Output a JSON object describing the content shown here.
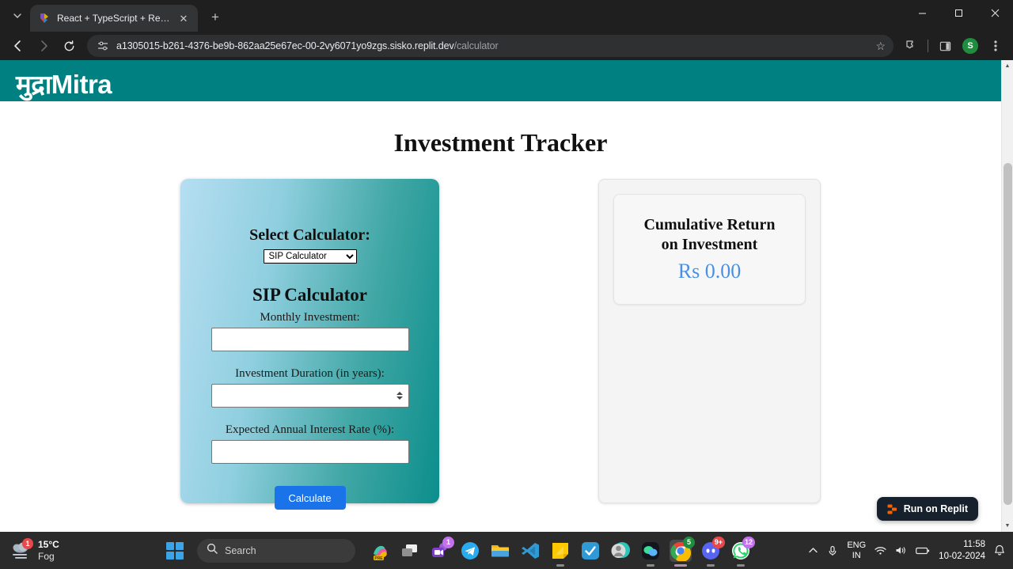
{
  "browser": {
    "tab": {
      "title": "React + TypeScript + Replit",
      "favicon_icon": "replit-favicon",
      "close_icon": "close-icon"
    },
    "tab_list_icon": "chevron-down-icon",
    "new_tab_icon": "plus-icon",
    "window": {
      "minimize_icon": "minimize-icon",
      "maximize_icon": "maximize-icon",
      "close_icon": "close-icon"
    },
    "nav": {
      "back_icon": "back-arrow-icon",
      "forward_icon": "forward-arrow-icon",
      "reload_icon": "reload-icon"
    },
    "omnibox": {
      "site_info_icon": "site-settings-icon",
      "host": "a1305015-b261-4376-be9b-862aa25e67ec-00-2vy6071yo9zgs.sisko.replit.dev",
      "path": "/calculator",
      "bookmark_icon": "star-icon"
    },
    "toolbar": {
      "extensions_icon": "puzzle-icon",
      "side_panel_icon": "side-panel-icon",
      "profile_initial": "S",
      "menu_icon": "three-dot-menu-icon"
    }
  },
  "site": {
    "logo_text": "मुद्राMitra",
    "header_color": "#008080",
    "page_title": "Investment Tracker",
    "calculator": {
      "select_label": "Select Calculator:",
      "selected_option": "SIP Calculator",
      "options": [
        "SIP Calculator"
      ],
      "heading": "SIP Calculator",
      "fields": [
        {
          "label": "Monthly Investment:",
          "value": "",
          "type": "text"
        },
        {
          "label": "Investment Duration (in years):",
          "value": "",
          "type": "number"
        },
        {
          "label": "Expected Annual Interest Rate (%):",
          "value": "",
          "type": "text"
        }
      ],
      "submit_label": "Calculate",
      "submit_color": "#1a73e8",
      "gradient_from": "#b6def2",
      "gradient_to": "#0b8e8c"
    },
    "result": {
      "title_line1": "Cumulative Return",
      "title_line2": "on Investment",
      "value": "Rs 0.00",
      "value_color": "#4a90e2"
    },
    "replit_badge": {
      "label": "Run on Replit",
      "icon": "replit-logo-icon"
    },
    "scrollbar": {
      "up_icon": "scroll-up-arrow-icon",
      "down_icon": "scroll-down-arrow-icon"
    }
  },
  "taskbar": {
    "weather": {
      "icon": "fog-cloud-icon",
      "badge": "1",
      "temperature": "15°C",
      "condition": "Fog"
    },
    "start_icon": "windows-start-icon",
    "search": {
      "icon": "search-icon",
      "placeholder": "Search"
    },
    "apps": [
      {
        "name": "copilot-pre-icon",
        "badge": "",
        "running": false
      },
      {
        "name": "task-view-icon",
        "badge": "",
        "running": false
      },
      {
        "name": "teams-icon",
        "badge": "1",
        "badge_color": "#c471ed",
        "running": false
      },
      {
        "name": "telegram-icon",
        "badge": "",
        "running": false
      },
      {
        "name": "file-explorer-icon",
        "badge": "",
        "running": false
      },
      {
        "name": "vscode-icon",
        "badge": "",
        "running": false
      },
      {
        "name": "sticky-notes-icon",
        "badge": "",
        "running": true
      },
      {
        "name": "todo-icon",
        "badge": "",
        "running": false
      },
      {
        "name": "contacts-icon",
        "badge": "",
        "running": false
      },
      {
        "name": "wechat-icon",
        "badge": "",
        "running": true
      },
      {
        "name": "chrome-icon",
        "badge": "5",
        "badge_color": "#1e8e3e",
        "running": true,
        "focused": true
      },
      {
        "name": "discord-icon",
        "badge": "9+",
        "badge_color": "#e8484c",
        "running": true
      },
      {
        "name": "whatsapp-icon",
        "badge": "12",
        "badge_color": "#c471ed",
        "running": true
      }
    ],
    "tray": {
      "chevron_icon": "show-hidden-icons-icon",
      "mic_icon": "microphone-icon",
      "language": "ENG",
      "region": "IN",
      "wifi_icon": "wifi-icon",
      "volume_icon": "volume-icon",
      "battery_icon": "battery-icon",
      "time": "11:58",
      "date": "10-02-2024",
      "notification_icon": "bell-icon"
    }
  }
}
